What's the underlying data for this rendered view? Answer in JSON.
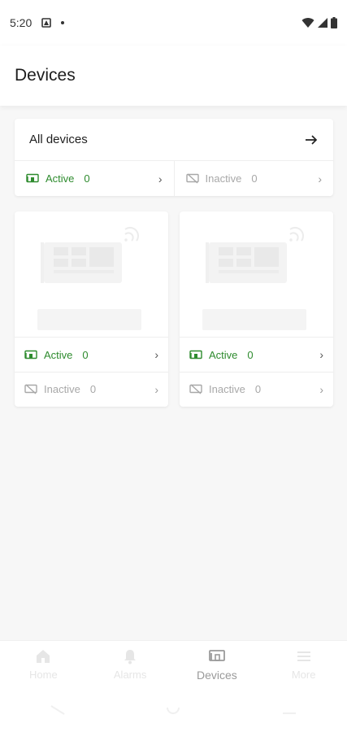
{
  "status_bar": {
    "time": "5:20"
  },
  "header": {
    "title": "Devices"
  },
  "all_devices": {
    "label": "All devices",
    "active_label": "Active",
    "active_count": "0",
    "inactive_label": "Inactive",
    "inactive_count": "0"
  },
  "groups": [
    {
      "active_label": "Active",
      "active_count": "0",
      "inactive_label": "Inactive",
      "inactive_count": "0"
    },
    {
      "active_label": "Active",
      "active_count": "0",
      "inactive_label": "Inactive",
      "inactive_count": "0"
    }
  ],
  "bottom_nav": {
    "items": [
      {
        "label": "Home",
        "icon": "home-icon"
      },
      {
        "label": "Alarms",
        "icon": "bell-icon"
      },
      {
        "label": "Devices",
        "icon": "devices-icon",
        "selected": true
      },
      {
        "label": "More",
        "icon": "menu-icon"
      }
    ]
  },
  "colors": {
    "active": "#2e8b2e",
    "inactive": "#a8a8a8",
    "background": "#f7f7f7"
  }
}
